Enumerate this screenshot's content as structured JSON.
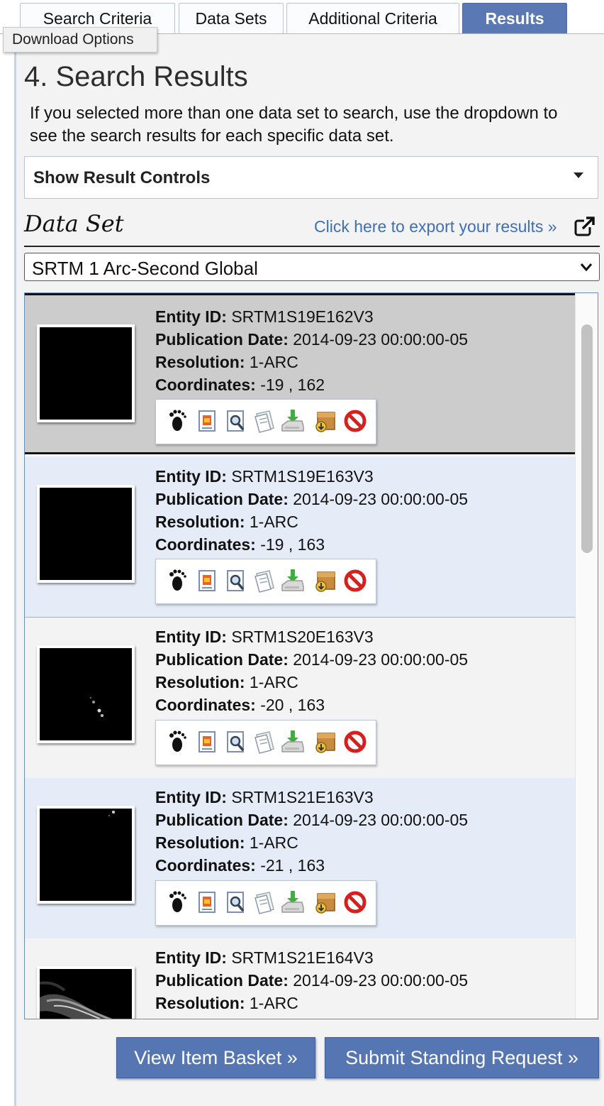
{
  "tabs": [
    {
      "label": "Search Criteria"
    },
    {
      "label": "Data Sets"
    },
    {
      "label": "Additional Criteria"
    },
    {
      "label": "Results",
      "active": true
    }
  ],
  "tooltip": "Download Options",
  "page": {
    "title": "4. Search Results",
    "intro": "If you selected more than one data set to search, use the dropdown to see the search results for each specific data set."
  },
  "result_controls": {
    "label": "Show Result Controls"
  },
  "dataset": {
    "heading": "Data Set",
    "export_link": "Click here to export your results »",
    "selected": "SRTM 1 Arc-Second Global"
  },
  "labels": {
    "entity": "Entity ID:",
    "pubdate": "Publication Date:",
    "resolution": "Resolution:",
    "coordinates": "Coordinates:"
  },
  "results": [
    {
      "entity_id": "SRTM1S19E162V3",
      "pub_date": "2014-09-23 00:00:00-05",
      "resolution": "1-ARC",
      "coordinates": "-19 , 162"
    },
    {
      "entity_id": "SRTM1S19E163V3",
      "pub_date": "2014-09-23 00:00:00-05",
      "resolution": "1-ARC",
      "coordinates": "-19 , 163"
    },
    {
      "entity_id": "SRTM1S20E163V3",
      "pub_date": "2014-09-23 00:00:00-05",
      "resolution": "1-ARC",
      "coordinates": "-20 , 163"
    },
    {
      "entity_id": "SRTM1S21E163V3",
      "pub_date": "2014-09-23 00:00:00-05",
      "resolution": "1-ARC",
      "coordinates": "-21 , 163"
    },
    {
      "entity_id": "SRTM1S21E164V3",
      "pub_date": "2014-09-23 00:00:00-05",
      "resolution": "1-ARC",
      "coordinates": ""
    }
  ],
  "row_icons": [
    "footprint-icon",
    "metadata-icon",
    "browse-overlay-icon",
    "compare-icon",
    "download-icon",
    "add-to-basket-icon",
    "exclude-icon"
  ],
  "buttons": {
    "basket": "View Item Basket »",
    "standing": "Submit Standing Request »"
  },
  "colors": {
    "accent": "#5a78b3",
    "link": "#3f6fb5",
    "row_alt": "#e6ecf7",
    "row_selected": "#cccccc"
  }
}
